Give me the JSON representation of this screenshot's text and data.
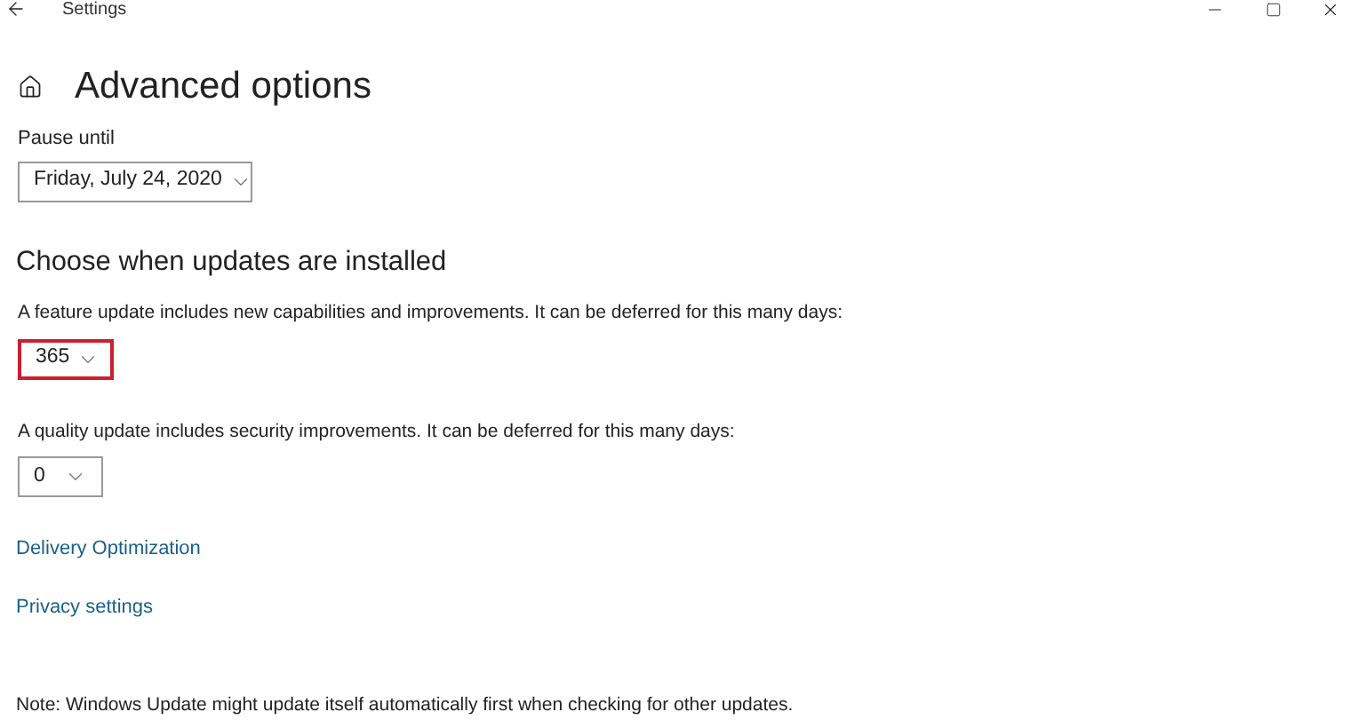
{
  "window": {
    "title": "Settings"
  },
  "page_title": "Advanced options",
  "pause": {
    "label": "Pause until",
    "value": "Friday, July 24, 2020"
  },
  "section_title": "Choose when updates are installed",
  "deferrals": [
    {
      "label": "A feature update includes new capabilities and improvements. It can be deferred for this many days:",
      "value": "365",
      "highlighted": true
    },
    {
      "label": "A quality update includes security improvements. It can be deferred for this many days:",
      "value": "0",
      "highlighted": false
    }
  ],
  "links": [
    "Delivery Optimization",
    "Privacy settings"
  ],
  "note": "Note: Windows Update might update itself automatically first when checking for other updates."
}
